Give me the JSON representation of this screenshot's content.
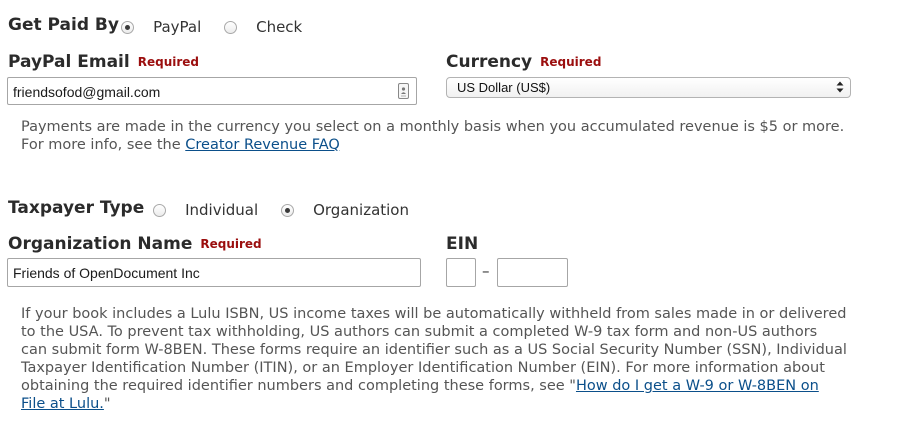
{
  "get_paid": {
    "label": "Get Paid By",
    "options": [
      {
        "label": "PayPal",
        "selected": true
      },
      {
        "label": "Check",
        "selected": false
      }
    ]
  },
  "paypal_email": {
    "label": "PayPal Email",
    "required": "Required",
    "value": "friendsofod@gmail.com"
  },
  "currency": {
    "label": "Currency",
    "required": "Required",
    "selected": "US Dollar (US$)"
  },
  "currency_help": {
    "line1": "Payments are made in the currency you select on a monthly basis when you accumulated revenue is $5 or more.",
    "line2_prefix": "For more info, see the ",
    "link": "Creator Revenue FAQ"
  },
  "taxpayer": {
    "label": "Taxpayer Type",
    "options": [
      {
        "label": "Individual",
        "selected": false
      },
      {
        "label": "Organization",
        "selected": true
      }
    ]
  },
  "org_name": {
    "label": "Organization Name",
    "required": "Required",
    "value": "Friends of OpenDocument Inc"
  },
  "ein": {
    "label": "EIN",
    "part1": "",
    "part2": "",
    "separator": "–"
  },
  "tax_help": {
    "lines": [
      "If your book includes a Lulu ISBN, US income taxes will be automatically withheld from sales made in or delivered",
      "to the USA. To prevent tax withholding, US authors can submit a completed W-9 tax form and non-US authors",
      "can submit form W-8BEN. These forms require an identifier such as a US Social Security Number (SSN), Individual",
      "Taxpayer Identification Number (ITIN), or an Employer Identification Number (EIN). For more information about"
    ],
    "line5_prefix": "obtaining the required identifier numbers and completing these forms, see \"",
    "link_part1": "How do I get a W-9 or W-8BEN on",
    "link_part2": "File at Lulu.",
    "suffix": "\""
  },
  "colors": {
    "required": "#9b0e0e",
    "link": "#0b4f8a",
    "text": "#333333"
  }
}
